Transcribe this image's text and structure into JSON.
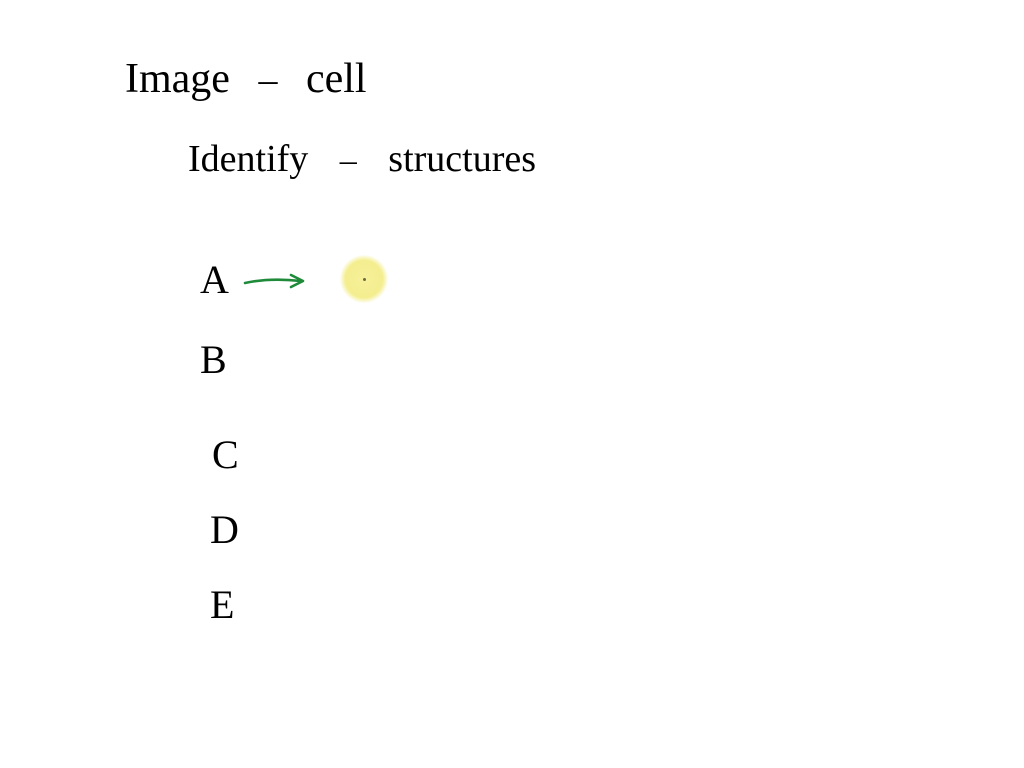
{
  "title_line": {
    "left": "Image",
    "sep": "–",
    "right": "cell"
  },
  "subtitle_line": {
    "left": "Identify",
    "sep": "–",
    "right": "structures"
  },
  "rows": {
    "a": "A",
    "b": "B",
    "c": "C",
    "d": "D",
    "e": "E"
  },
  "arrow": {
    "color": "#1f8a3a",
    "from_label": "A",
    "to": "highlight"
  },
  "highlight": {
    "color": "#f4ee8f"
  }
}
